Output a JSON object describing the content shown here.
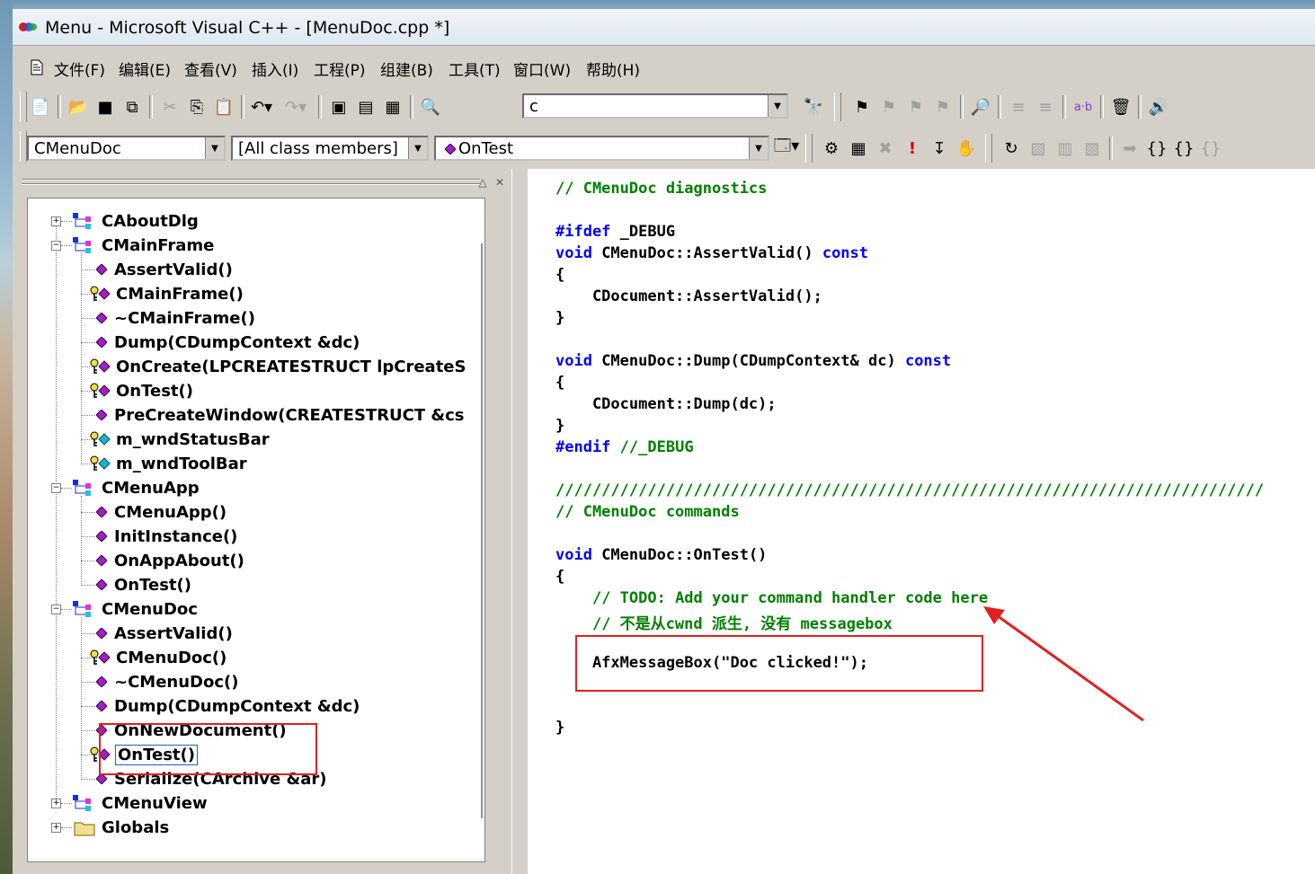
{
  "window": {
    "title": "Menu - Microsoft Visual C++ - [MenuDoc.cpp *]"
  },
  "menu": [
    "文件(F)",
    "编辑(E)",
    "查看(V)",
    "插入(I)",
    "工程(P)",
    "组建(B)",
    "工具(T)",
    "窗口(W)",
    "帮助(H)"
  ],
  "toolbar": {
    "find_value": "c",
    "replace_label": "a·b"
  },
  "wizardbar": {
    "class_combo": "CMenuDoc",
    "filter_combo": "[All class members]",
    "member_combo": "OnTest"
  },
  "tree": [
    {
      "label": "CAboutDlg",
      "kind": "class",
      "expander": "+"
    },
    {
      "label": "CMainFrame",
      "kind": "class",
      "expander": "-"
    },
    {
      "label": "AssertValid()",
      "kind": "method"
    },
    {
      "label": "CMainFrame()",
      "kind": "protected"
    },
    {
      "label": "~CMainFrame()",
      "kind": "method"
    },
    {
      "label": "Dump(CDumpContext &dc)",
      "kind": "method"
    },
    {
      "label": "OnCreate(LPCREATESTRUCT lpCreateS",
      "kind": "protected"
    },
    {
      "label": "OnTest()",
      "kind": "protected"
    },
    {
      "label": "PreCreateWindow(CREATESTRUCT &cs",
      "kind": "method"
    },
    {
      "label": "m_wndStatusBar",
      "kind": "member"
    },
    {
      "label": "m_wndToolBar",
      "kind": "member"
    },
    {
      "label": "CMenuApp",
      "kind": "class",
      "expander": "-"
    },
    {
      "label": "CMenuApp()",
      "kind": "method"
    },
    {
      "label": "InitInstance()",
      "kind": "method"
    },
    {
      "label": "OnAppAbout()",
      "kind": "method"
    },
    {
      "label": "OnTest()",
      "kind": "method"
    },
    {
      "label": "CMenuDoc",
      "kind": "class",
      "expander": "-"
    },
    {
      "label": "AssertValid()",
      "kind": "method"
    },
    {
      "label": "CMenuDoc()",
      "kind": "protected"
    },
    {
      "label": "~CMenuDoc()",
      "kind": "method"
    },
    {
      "label": "Dump(CDumpContext &dc)",
      "kind": "method"
    },
    {
      "label": "OnNewDocument()",
      "kind": "method"
    },
    {
      "label": "OnTest()",
      "kind": "protected",
      "selected": true
    },
    {
      "label": "Serialize(CArchive &ar)",
      "kind": "method"
    },
    {
      "label": "CMenuView",
      "kind": "class",
      "expander": "+"
    },
    {
      "label": "Globals",
      "kind": "folder",
      "expander": "+"
    }
  ],
  "code": [
    "// CMenuDoc diagnostics",
    "",
    "#ifdef _DEBUG",
    "void CMenuDoc::AssertValid() const",
    "{",
    "    CDocument::AssertValid();",
    "}",
    "",
    "void CMenuDoc::Dump(CDumpContext& dc) const",
    "{",
    "    CDocument::Dump(dc);",
    "}",
    "#endif //_DEBUG",
    "",
    "/////////////////////////////////////////////////////////////////////////////",
    "// CMenuDoc commands",
    "",
    "void CMenuDoc::OnTest()",
    "{",
    "    // TODO: Add your command handler code here",
    "    // 不是从cwnd 派生, 没有 messagebox",
    "",
    "    AfxMessageBox(\"Doc clicked!\");",
    "",
    "",
    "}"
  ],
  "colors": {
    "keyword": "#0000ff",
    "comment": "#008000",
    "annotation": "#e02020"
  }
}
